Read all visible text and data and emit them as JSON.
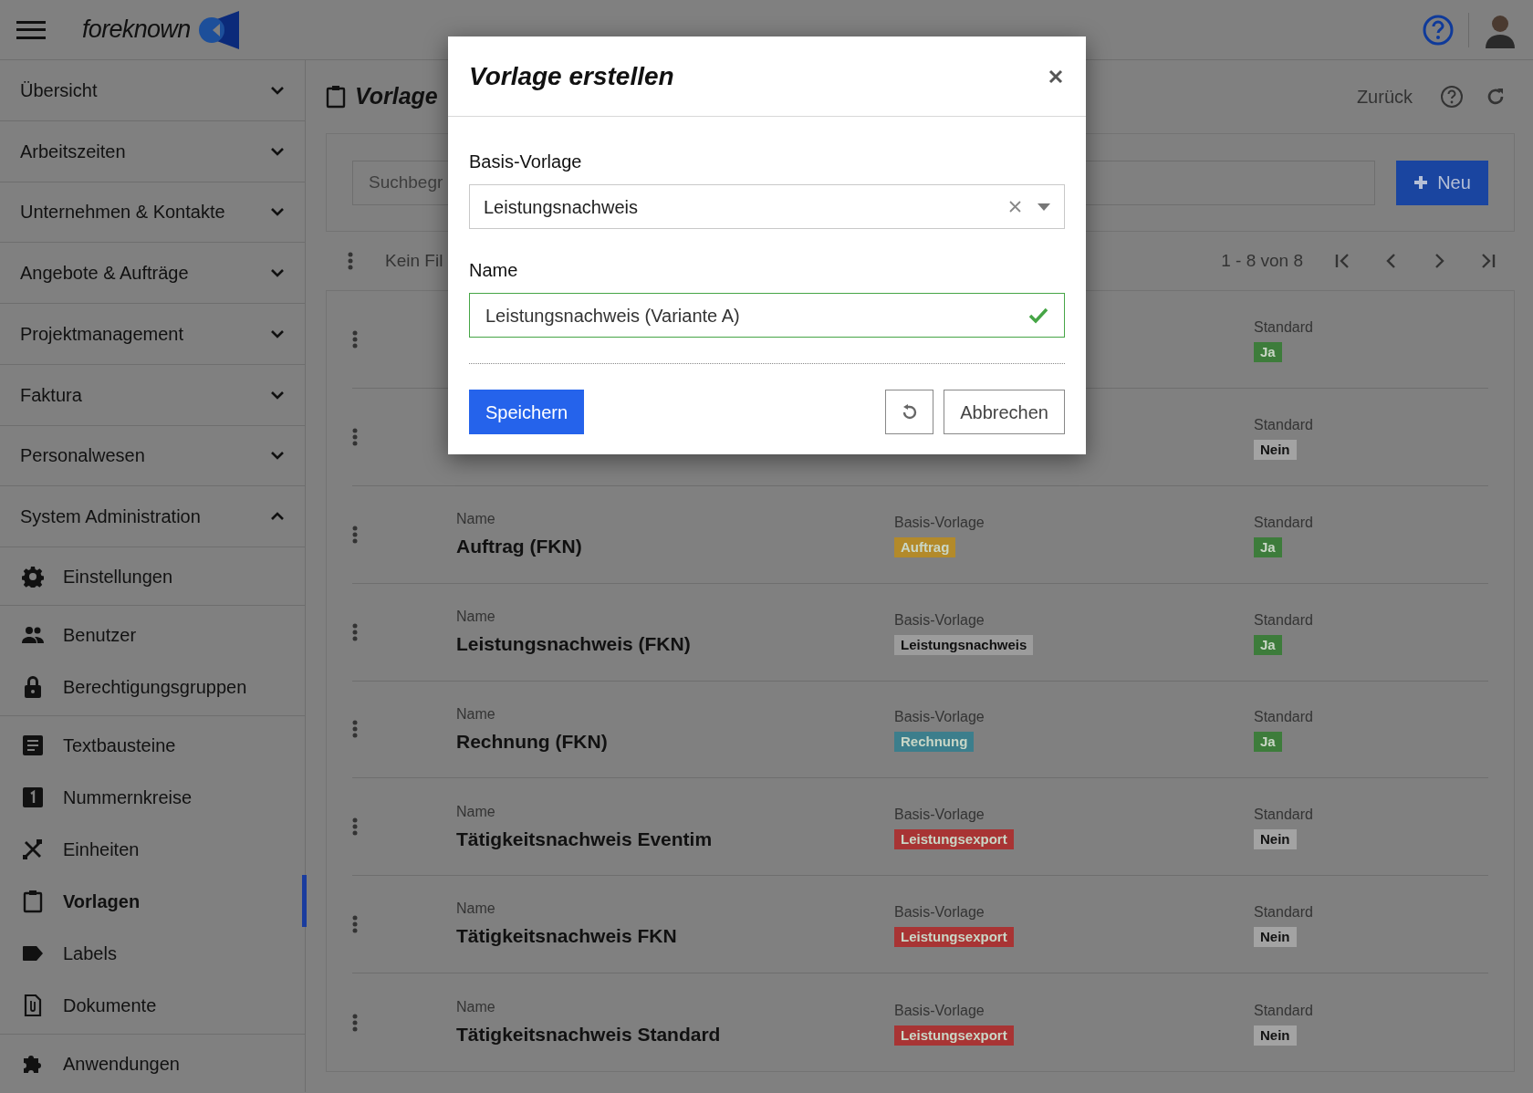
{
  "header": {
    "logo": "foreknown"
  },
  "sidebar": {
    "sections": [
      {
        "label": "Übersicht",
        "expanded": false
      },
      {
        "label": "Arbeitszeiten",
        "expanded": false
      },
      {
        "label": "Unternehmen & Kontakte",
        "expanded": false
      },
      {
        "label": "Angebote & Aufträge",
        "expanded": false
      },
      {
        "label": "Projektmanagement",
        "expanded": false
      },
      {
        "label": "Faktura",
        "expanded": false
      },
      {
        "label": "Personalwesen",
        "expanded": false
      },
      {
        "label": "System Administration",
        "expanded": true
      }
    ],
    "item_groups": [
      [
        {
          "label": "Einstellungen",
          "selected": false
        }
      ],
      [
        {
          "label": "Benutzer",
          "selected": false
        },
        {
          "label": "Berechtigungsgruppen",
          "selected": false
        }
      ],
      [
        {
          "label": "Textbausteine",
          "selected": false
        },
        {
          "label": "Nummernkreise",
          "selected": false
        },
        {
          "label": "Einheiten",
          "selected": false
        },
        {
          "label": "Vorlagen",
          "selected": true
        },
        {
          "label": "Labels",
          "selected": false
        },
        {
          "label": "Dokumente",
          "selected": false
        }
      ],
      [
        {
          "label": "Anwendungen",
          "selected": false
        }
      ]
    ]
  },
  "page": {
    "title": "Vorlage",
    "back": "Zurück",
    "search": {
      "placeholder": "Suchbegr"
    },
    "new_button": "Neu",
    "filter": "Kein Fil",
    "pagination": "1 - 8 von 8"
  },
  "rows": [
    {
      "standard_label": "Standard",
      "standard": {
        "text": "Ja",
        "color": "#3d7c3b"
      }
    },
    {
      "standard_label": "Standard",
      "standard": {
        "text": "Nein",
        "color": "#a3a3a3"
      }
    },
    {
      "name_label": "Name",
      "name": "Auftrag (FKN)",
      "basis_label": "Basis-Vorlage",
      "basis": {
        "text": "Auftrag",
        "color": "#b38a2a"
      },
      "standard_label": "Standard",
      "standard": {
        "text": "Ja",
        "color": "#3d7c3b"
      }
    },
    {
      "name_label": "Name",
      "name": "Leistungsnachweis (FKN)",
      "basis_label": "Basis-Vorlage",
      "basis": {
        "text": "Leistungsnachweis",
        "color": "#9c9c9c"
      },
      "standard_label": "Standard",
      "standard": {
        "text": "Ja",
        "color": "#3d7c3b"
      }
    },
    {
      "name_label": "Name",
      "name": "Rechnung (FKN)",
      "basis_label": "Basis-Vorlage",
      "basis": {
        "text": "Rechnung",
        "color": "#3c7e8c"
      },
      "standard_label": "Standard",
      "standard": {
        "text": "Ja",
        "color": "#3d7c3b"
      }
    },
    {
      "name_label": "Name",
      "name": "Tätigkeitsnachweis Eventim",
      "basis_label": "Basis-Vorlage",
      "basis": {
        "text": "Leistungsexport",
        "color": "#a83434"
      },
      "standard_label": "Standard",
      "standard": {
        "text": "Nein",
        "color": "#a3a3a3"
      }
    },
    {
      "name_label": "Name",
      "name": "Tätigkeitsnachweis FKN",
      "basis_label": "Basis-Vorlage",
      "basis": {
        "text": "Leistungsexport",
        "color": "#a83434"
      },
      "standard_label": "Standard",
      "standard": {
        "text": "Nein",
        "color": "#a3a3a3"
      }
    },
    {
      "name_label": "Name",
      "name": "Tätigkeitsnachweis Standard",
      "basis_label": "Basis-Vorlage",
      "basis": {
        "text": "Leistungsexport",
        "color": "#a83434"
      },
      "standard_label": "Standard",
      "standard": {
        "text": "Nein",
        "color": "#a3a3a3"
      }
    }
  ],
  "dialog": {
    "title": "Vorlage erstellen",
    "basis_label": "Basis-Vorlage",
    "basis_value": "Leistungsnachweis",
    "name_label": "Name",
    "name_value": "Leistungsnachweis (Variante A)",
    "name_valid": true,
    "save": "Speichern",
    "cancel": "Abbrechen"
  }
}
